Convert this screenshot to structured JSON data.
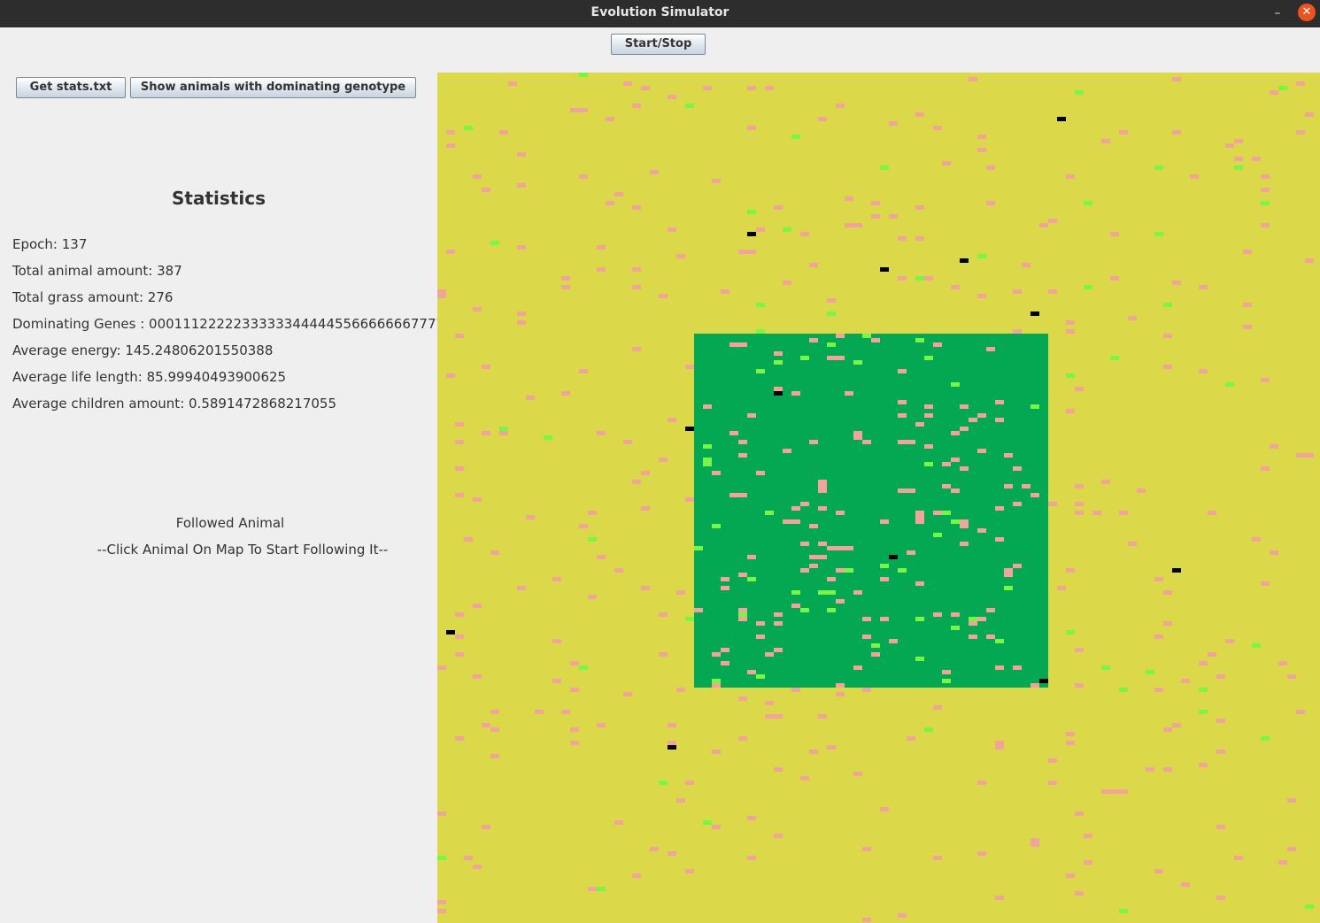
{
  "window": {
    "title": "Evolution Simulator"
  },
  "controls": {
    "start_stop": "Start/Stop",
    "get_stats": "Get stats.txt",
    "show_dominating": "Show animals with dominating genotype"
  },
  "statistics": {
    "title": "Statistics",
    "epoch": "Epoch: 137",
    "total_animals": "Total animal amount: 387",
    "total_grass": "Total grass amount: 276",
    "dominating_genes": "Dominating Genes : 00011122222333333444445566666667777",
    "average_energy": "Average energy: 145.24806201550388",
    "average_life": "Average life length: 85.99940493900625",
    "average_children": "Average children amount: 0.5891472868217055"
  },
  "followed": {
    "title": "Followed Animal",
    "hint": "--Click Animal On Map To Start Following It--"
  },
  "map_colors": {
    "steppe": "#dbd94a",
    "jungle": "#04a752",
    "animal": "#f2a39a",
    "grass": "#78f545",
    "dominating": "#000000"
  }
}
